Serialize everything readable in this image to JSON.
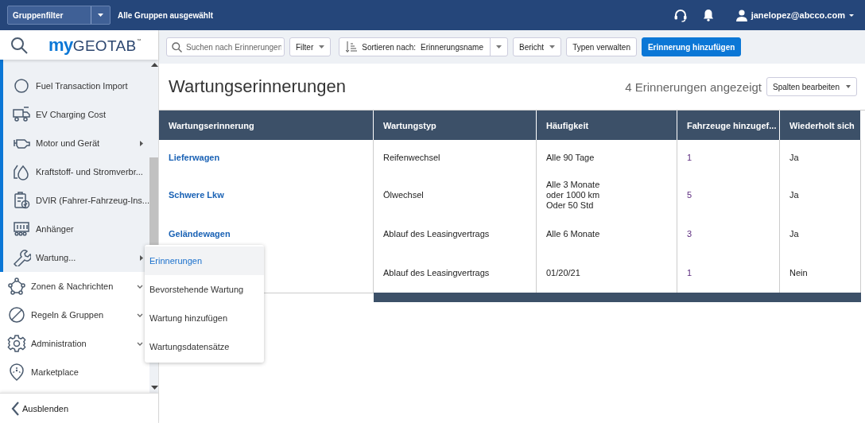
{
  "top_bar": {
    "group_filter": "Gruppenfilter",
    "group_status": "Alle Gruppen ausgewählt",
    "user": "janelopez@abcco.com"
  },
  "logo": {
    "prefix": "my",
    "name": "GEOTAB",
    "mark": "™"
  },
  "sidebar": {
    "items": [
      {
        "label": "Fuel Transaction Import",
        "kind": "sub",
        "has_submenu": false
      },
      {
        "label": "EV Charging Cost",
        "kind": "sub",
        "has_submenu": false
      },
      {
        "label": "Motor und Gerät",
        "kind": "sub",
        "has_submenu": true
      },
      {
        "label": "Kraftstoff- und Stromverbr...",
        "kind": "sub",
        "has_submenu": false
      },
      {
        "label": "DVIR (Fahrer-Fahrzeug-Ins...",
        "kind": "sub",
        "has_submenu": false
      },
      {
        "label": "Anhänger",
        "kind": "sub",
        "has_submenu": false
      },
      {
        "label": "Wartung...",
        "kind": "sub",
        "has_submenu": true
      },
      {
        "label": "Zonen & Nachrichten",
        "kind": "top",
        "has_submenu": true
      },
      {
        "label": "Regeln & Gruppen",
        "kind": "top",
        "has_submenu": true
      },
      {
        "label": "Administration",
        "kind": "top",
        "has_submenu": true
      },
      {
        "label": "Marketplace",
        "kind": "top",
        "has_submenu": false
      }
    ],
    "collapse": "Ausblenden"
  },
  "submenu": [
    {
      "label": "Erinnerungen",
      "selected": true
    },
    {
      "label": "Bevorstehende Wartung",
      "selected": false
    },
    {
      "label": "Wartung hinzufügen",
      "selected": false
    },
    {
      "label": "Wartungsdatensätze",
      "selected": false
    }
  ],
  "toolbar": {
    "search": {
      "placeholder": "Suchen nach Erinnerungen"
    },
    "filter": "Filter",
    "sort_label": "Sortieren nach:",
    "sort_value": "Erinnerungsname",
    "report": "Bericht",
    "manage_types": "Typen verwalten",
    "add": "Erinnerung hinzufügen"
  },
  "page": {
    "title": "Wartungserinnerungen",
    "count": "4 Erinnerungen angezeigt",
    "edit_columns": "Spalten bearbeiten"
  },
  "table": {
    "columns": [
      {
        "label": "Wartungserinnerung",
        "kind": "name"
      },
      {
        "label": "Wartungstyp",
        "kind": "text"
      },
      {
        "label": "Häufigkeit",
        "kind": "text"
      },
      {
        "label": "Fahrzeuge hinzugef...",
        "kind": "count"
      },
      {
        "label": "Wiederholt sich",
        "kind": "text"
      }
    ],
    "rows": [
      {
        "cells": [
          "Lieferwagen",
          "Reifenwechsel",
          "Alle 90 Tage",
          "1",
          "Ja"
        ]
      },
      {
        "cells": [
          "Schwere Lkw",
          "Ölwechsel",
          "Alle 3 Monate\noder 1000 km\nOder 50 Std",
          "5",
          "Ja"
        ]
      },
      {
        "cells": [
          "Geländewagen",
          "Ablauf des Leasingvertrags",
          "Alle 6 Monate",
          "3",
          "Ja"
        ]
      },
      {
        "cells": [
          null,
          "Ablauf des Leasingvertrags",
          "01/20/21",
          "1",
          "Nein"
        ]
      }
    ]
  }
}
